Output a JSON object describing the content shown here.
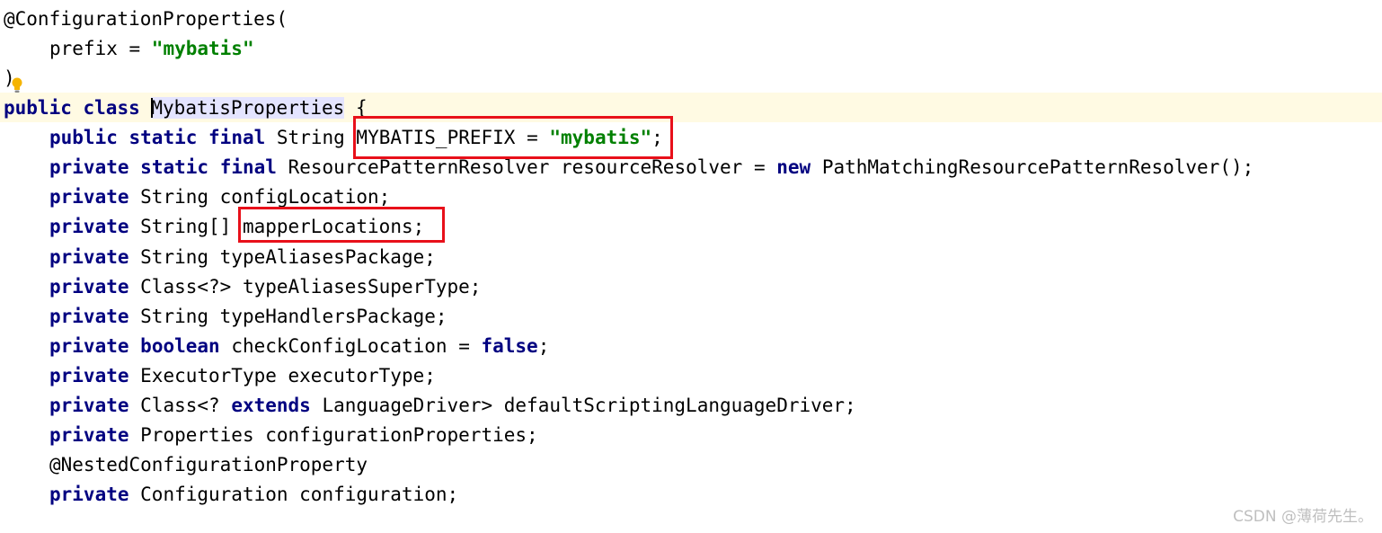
{
  "code": {
    "line1": {
      "annotation": "@ConfigurationProperties("
    },
    "line2": {
      "name": "prefix",
      "op": " = ",
      "value": "\"mybatis\""
    },
    "line3": {
      "text": ")"
    },
    "line4": {
      "kw1": "public",
      "kw2": "class",
      "class_name": "MybatisProperties",
      "brace": " {"
    },
    "line5": {
      "kw1": "public",
      "kw2": "static",
      "kw3": "final",
      "type": "String",
      "field": "MYBATIS_PREFIX",
      "op": " = ",
      "value": "\"mybatis\"",
      "end": ";"
    },
    "line6": {
      "kw1": "private",
      "kw2": "static",
      "kw3": "final",
      "type": "ResourcePatternResolver",
      "field": "resourceResolver",
      "op": " = ",
      "kw4": "new",
      "rest": " PathMatchingResourcePatternResolver();"
    },
    "line7": {
      "kw1": "private",
      "rest": " String configLocation;"
    },
    "line8": {
      "kw1": "private",
      "type": " String[] ",
      "field": "mapperLocations;"
    },
    "line9": {
      "kw1": "private",
      "rest": " String typeAliasesPackage;"
    },
    "line10": {
      "kw1": "private",
      "rest": " Class<?> typeAliasesSuperType;"
    },
    "line11": {
      "kw1": "private",
      "rest": " String typeHandlersPackage;"
    },
    "line12": {
      "kw1": "private",
      "kw2": "boolean",
      "middle": " checkConfigLocation = ",
      "kw3": "false",
      "end": ";"
    },
    "line13": {
      "kw1": "private",
      "rest": " ExecutorType executorType;"
    },
    "line14": {
      "kw1": "private",
      "pre": " Class<? ",
      "kw2": "extends",
      "rest": " LanguageDriver> defaultScriptingLanguageDriver;"
    },
    "line15": {
      "kw1": "private",
      "rest": " Properties configurationProperties;"
    },
    "line16": {
      "annotation": "@NestedConfigurationProperty"
    },
    "line17": {
      "kw1": "private",
      "rest": " Configuration configuration;"
    }
  },
  "icons": {
    "intention_bulb": "lightbulb-icon"
  },
  "colors": {
    "keyword": "#000080",
    "string": "#008000",
    "highlight_box": "#e8101a",
    "caret_line": "#fffae3"
  },
  "watermark": "CSDN @薄荷先生。"
}
